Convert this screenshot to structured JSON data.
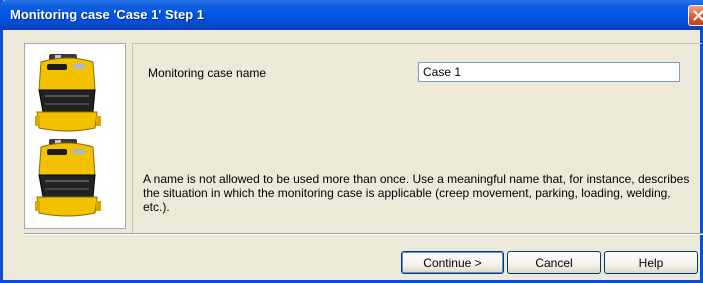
{
  "window": {
    "title": "Monitoring case 'Case 1' Step 1"
  },
  "form": {
    "name_label": "Monitoring case name",
    "name_value": "Case 1",
    "help_text": "A name is not allowed to be used more than once. Use a meaningful name that, for instance, describes the situation in which the monitoring case is applicable (creep movement, parking, loading, welding, etc.)."
  },
  "buttons": {
    "continue_label": "Continue >",
    "cancel_label": "Cancel",
    "help_label": "Help"
  },
  "icons": {
    "close": "close-icon",
    "scanner": "laser-scanner-icon"
  },
  "colors": {
    "title_bar": "#0054e3",
    "close_button": "#e2582b",
    "dialog_bg": "#ece9d8",
    "scanner_yellow": "#f2c200"
  }
}
